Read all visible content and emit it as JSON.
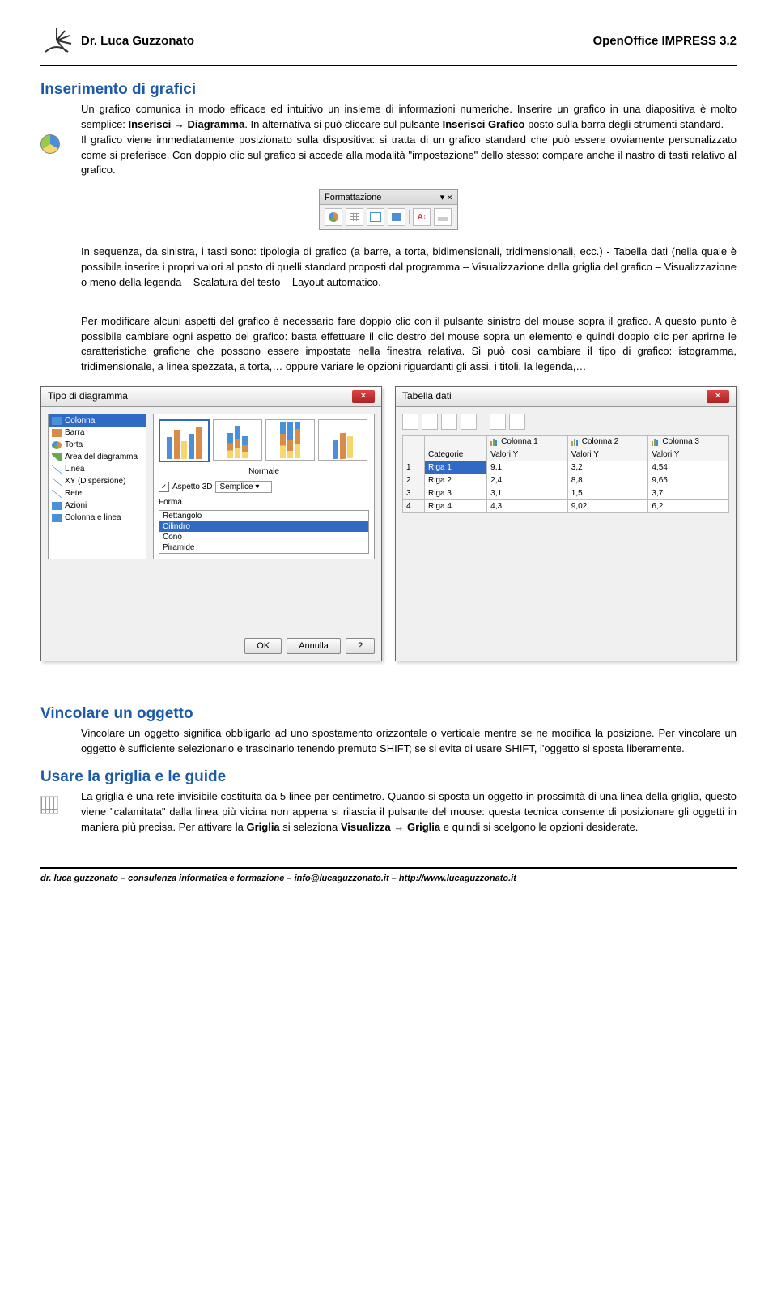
{
  "header": {
    "author": "Dr. Luca Guzzonato",
    "product": "OpenOffice IMPRESS 3.2"
  },
  "sections": {
    "s1": {
      "title": "Inserimento di grafici",
      "p1a": "Un grafico comunica in modo efficace ed intuitivo un insieme di informazioni numeriche. Inserire un grafico in una diapositiva è molto semplice: ",
      "p1b": "Inserisci → Diagramma",
      "p1c": ". In alternativa si può cliccare sul pulsante ",
      "p1d": "Inserisci Grafico",
      "p1e": " posto sulla barra degli strumenti standard.",
      "p2": "Il grafico viene immediatamente posizionato sulla dispositiva: si tratta di un grafico standard che può essere ovviamente personalizzato come si preferisce. Con doppio clic sul grafico si accede alla modalità \"impostazione\" dello stesso: compare anche il nastro di tasti relativo al grafico.",
      "p3": "In sequenza, da sinistra, i tasti sono: tipologia di grafico (a barre, a torta, bidimensionali, tridimensionali, ecc.) - Tabella dati (nella quale è possibile inserire i propri valori al posto di quelli standard proposti dal programma – Visualizzazione della griglia del grafico – Visualizzazione o meno della legenda – Scalatura del testo – Layout automatico.",
      "p4": "Per modificare alcuni aspetti del grafico è necessario fare doppio clic con il pulsante sinistro del mouse sopra il grafico. A questo punto è possibile cambiare ogni aspetto del grafico: basta effettuare il clic destro del mouse sopra un elemento e quindi doppio clic per aprirne le caratteristiche grafiche che possono essere impostate nella finestra relativa. Si può così cambiare il tipo di grafico: istogramma, tridimensionale, a linea spezzata, a torta,… oppure variare le opzioni riguardanti gli assi, i titoli, la legenda,…"
    },
    "s2": {
      "title": "Vincolare un oggetto",
      "p1": "Vincolare un oggetto significa obbligarlo ad uno spostamento orizzontale o verticale mentre se ne modifica la posizione. Per vincolare un oggetto è sufficiente selezionarlo e trascinarlo tenendo premuto SHIFT; se si evita di usare SHIFT, l'oggetto si sposta liberamente."
    },
    "s3": {
      "title": "Usare la griglia e le guide",
      "p1a": "La griglia è una rete invisibile costituita da 5 linee per centimetro. Quando si sposta un oggetto in prossimità di una linea della griglia, questo viene \"calamitata\" dalla linea più vicina non appena si rilascia il pulsante del mouse: questa tecnica consente di posizionare gli oggetti in maniera più precisa. Per attivare la ",
      "p1b": "Griglia",
      "p1c": " si seleziona ",
      "p1d": "Visualizza → Griglia",
      "p1e": " e quindi si scelgono le opzioni desiderate."
    }
  },
  "fmt_toolbar": {
    "title": "Formattazione",
    "dropdown": "▾",
    "close": "×"
  },
  "dialog1": {
    "title": "Tipo di diagramma",
    "types": [
      "Colonna",
      "Barra",
      "Torta",
      "Area del diagramma",
      "Linea",
      "XY (Dispersione)",
      "Rete",
      "Azioni",
      "Colonna e linea"
    ],
    "preview_label": "Normale",
    "aspect3d": "Aspetto 3D",
    "aspect3d_val": "Semplice",
    "shape_label": "Forma",
    "shapes": [
      "Rettangolo",
      "Cilindro",
      "Cono",
      "Piramide"
    ],
    "btn_ok": "OK",
    "btn_cancel": "Annulla",
    "btn_help": "?"
  },
  "dialog2": {
    "title": "Tabella dati",
    "cols": [
      "Colonna 1",
      "Colonna 2",
      "Colonna 3"
    ],
    "sub": [
      "Categorie",
      "Valori Y",
      "Valori Y",
      "Valori Y"
    ],
    "rows": [
      {
        "n": "1",
        "cat": "Riga 1",
        "v": [
          "9,1",
          "3,2",
          "4,54"
        ]
      },
      {
        "n": "2",
        "cat": "Riga 2",
        "v": [
          "2,4",
          "8,8",
          "9,65"
        ]
      },
      {
        "n": "3",
        "cat": "Riga 3",
        "v": [
          "3,1",
          "1,5",
          "3,7"
        ]
      },
      {
        "n": "4",
        "cat": "Riga 4",
        "v": [
          "4,3",
          "9,02",
          "6,2"
        ]
      }
    ]
  },
  "footer": "dr. luca guzzonato – consulenza informatica e formazione – info@lucaguzzonato.it – http://www.lucaguzzonato.it"
}
